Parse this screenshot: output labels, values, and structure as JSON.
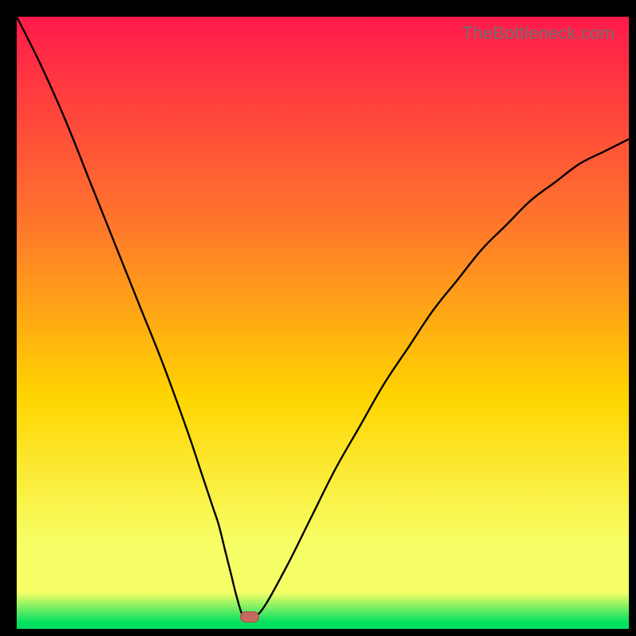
{
  "watermark": "TheBottleneck.com",
  "colors": {
    "gradient_top": "#ff1a4b",
    "gradient_upper_mid": "#ff7a2a",
    "gradient_mid": "#ffd400",
    "gradient_lower": "#f7ff66",
    "gradient_bottom": "#00e060",
    "curve": "#000000",
    "marker_fill": "#c46a5f",
    "marker_stroke": "#a84f44",
    "background": "#000000"
  },
  "chart_data": {
    "type": "line",
    "title": "",
    "xlabel": "",
    "ylabel": "",
    "xlim": [
      0,
      100
    ],
    "ylim": [
      0,
      100
    ],
    "grid": false,
    "minimum_x": 37,
    "minimum_y": 2,
    "marker": {
      "x": 38,
      "y": 2
    },
    "x": [
      0,
      4,
      8,
      12,
      16,
      20,
      24,
      28,
      30,
      32,
      33,
      34,
      35,
      36,
      37,
      38,
      40,
      44,
      48,
      52,
      56,
      60,
      64,
      68,
      72,
      76,
      80,
      84,
      88,
      92,
      96,
      100
    ],
    "values": [
      100,
      92,
      83,
      73,
      63,
      53,
      43,
      32,
      26,
      20,
      17,
      13,
      9,
      5,
      2,
      2,
      3,
      10,
      18,
      26,
      33,
      40,
      46,
      52,
      57,
      62,
      66,
      70,
      73,
      76,
      78,
      80
    ]
  }
}
